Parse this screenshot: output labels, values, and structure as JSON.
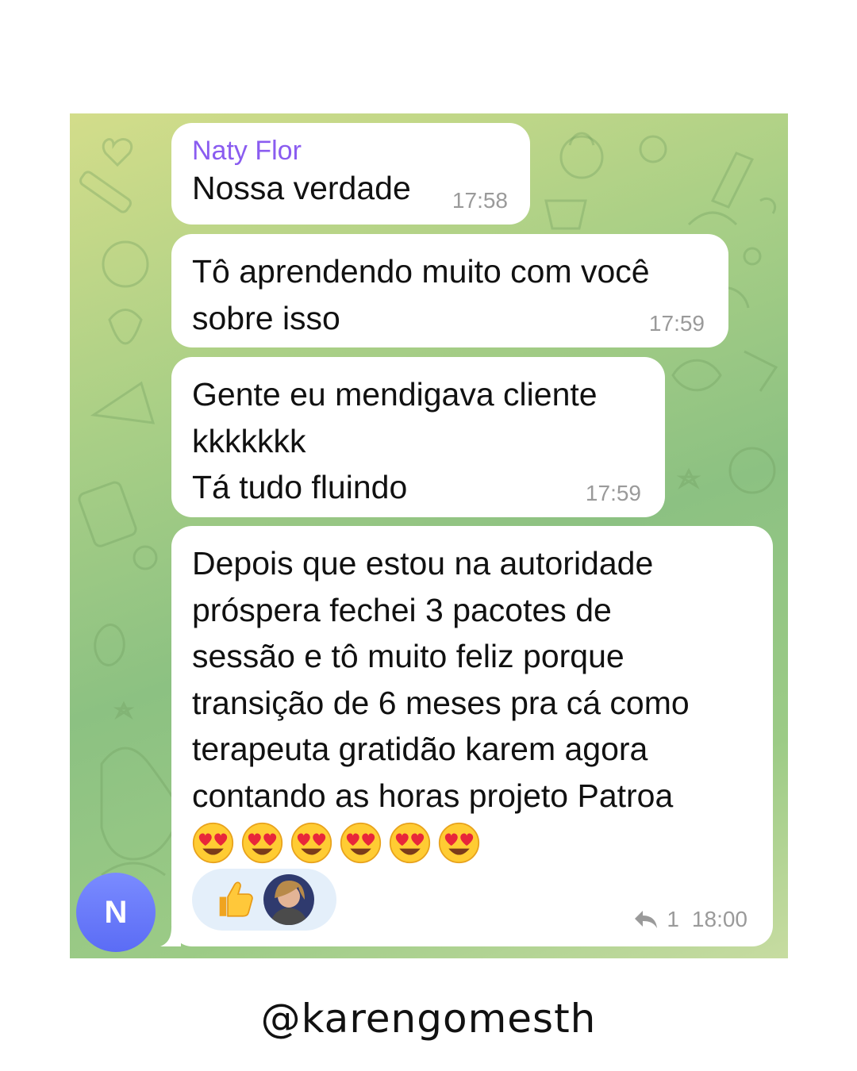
{
  "chat": {
    "messages": [
      {
        "sender": "Naty Flor",
        "text": "Nossa verdade",
        "time": "17:58"
      },
      {
        "text": "Tô aprendendo muito com você\nsobre isso",
        "time": "17:59"
      },
      {
        "text": "Gente eu mendigava cliente\nkkkkkkk\nTá tudo fluindo",
        "time": "17:59"
      },
      {
        "text": "Depois que estou na autoridade\npróspera fechei 3 pacotes de\nsessão e tô muito feliz porque\ntransição de 6 meses pra cá como\nterapeuta gratidão karem agora\ncontando as horas projeto Patroa",
        "emojis": [
          "heart-eyes",
          "heart-eyes",
          "heart-eyes",
          "heart-eyes",
          "heart-eyes",
          "heart-eyes"
        ],
        "reaction_emoji": "👍",
        "reply_count": "1",
        "time": "18:00"
      }
    ],
    "sender_avatar_initial": "N"
  },
  "footer": {
    "handle": "@karengomesth"
  }
}
